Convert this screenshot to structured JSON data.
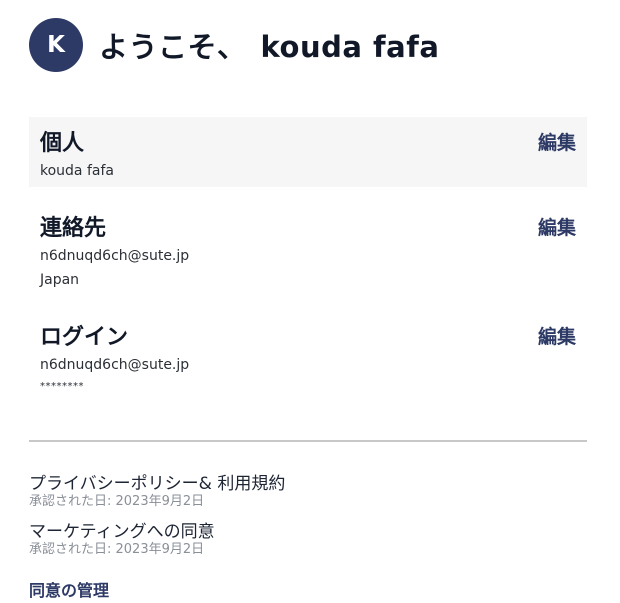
{
  "header": {
    "avatar_initial": "K",
    "welcome_text": "ようこそ、",
    "user_name": "kouda fafa"
  },
  "sections": {
    "personal": {
      "title": "個人",
      "edit_label": "編集",
      "name": "kouda fafa"
    },
    "contact": {
      "title": "連絡先",
      "edit_label": "編集",
      "email": "n6dnuqd6ch@sute.jp",
      "country": "Japan"
    },
    "login": {
      "title": "ログイン",
      "edit_label": "編集",
      "email": "n6dnuqd6ch@sute.jp",
      "password_mask": "********"
    }
  },
  "consents": {
    "privacy": {
      "title": "プライバシーポリシー& 利用規約",
      "accepted": "承認された日: 2023年9月2日"
    },
    "marketing": {
      "title": "マーケティングへの同意",
      "accepted": "承認された日: 2023年9月2日"
    },
    "manage_label": "同意の管理"
  },
  "colors": {
    "accent": "#2e3a66",
    "shaded_background": "#f6f6f6",
    "muted_text": "#8a8f98"
  }
}
